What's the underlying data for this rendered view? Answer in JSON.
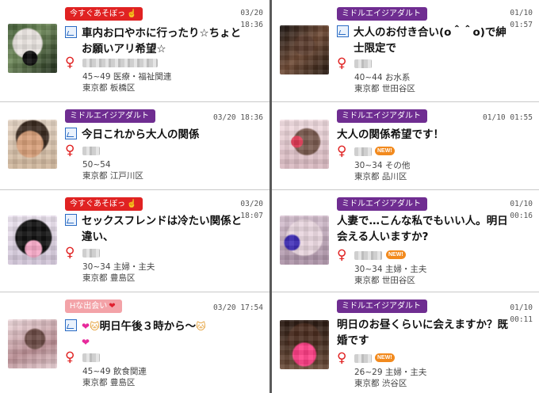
{
  "badges": {
    "now": "今すぐあそぼっ",
    "middle": "ミドルエイジアダルト",
    "h": "Hな出会い"
  },
  "new_label": "NEW!",
  "colors": {
    "now_badge": "#e02222",
    "middle_badge": "#6f2d91",
    "h_badge": "#f3a3a8",
    "gender_icon": "#e02222",
    "new_badge": "#f28a1e"
  },
  "icons": {
    "image": "image-icon",
    "gender": "female-icon",
    "heart": "heart-icon",
    "cat": "cat-face-icon"
  },
  "left": [
    {
      "badge": "今すぐあそぼっ",
      "date": "03/20",
      "time": "18:36",
      "title": "車内お口やホに行ったり☆ちょとお願いアリ希望☆",
      "age_job": "45~49 医療・福祉関連",
      "area": "東京都 板橋区"
    },
    {
      "badge": "ミドルエイジアダルト",
      "date": "03/20",
      "time": "18:36",
      "title": "今日これから大人の関係",
      "age_job": "50~54",
      "area": "東京都 江戸川区"
    },
    {
      "badge": "今すぐあそぼっ",
      "date": "03/20",
      "time": "18:07",
      "title": "セックスフレンドは冷たい関係と違い、",
      "age_job": "30~34 主婦・主夫",
      "area": "東京都 豊島区"
    },
    {
      "badge": "Hな出会い",
      "date": "03/20",
      "time": "17:54",
      "title": "明日午後３時から～",
      "age_job": "45~49 飲食関連",
      "area": "東京都 豊島区"
    }
  ],
  "right": [
    {
      "badge": "ミドルエイジアダルト",
      "date": "01/10",
      "time": "01:57",
      "title": "大人のお付き合い(o＾＾o)で紳士限定で",
      "age_job": "40~44 お水系",
      "area": "東京都 世田谷区"
    },
    {
      "badge": "ミドルエイジアダルト",
      "date": "01/10",
      "time": "01:55",
      "title": "大人の関係希望です！",
      "age_job": "30~34 その他",
      "area": "東京都 品川区"
    },
    {
      "badge": "ミドルエイジアダルト",
      "date": "01/10",
      "time": "00:16",
      "title": "人妻で…こんな私でもいい人。明日会える人いますか?",
      "age_job": "30~34 主婦・主夫",
      "area": "東京都 世田谷区"
    },
    {
      "badge": "ミドルエイジアダルト",
      "date": "01/10",
      "time": "00:11",
      "title": "明日のお昼くらいに会えますか？既婚です",
      "age_job": "26~29 主婦・主夫",
      "area": "東京都 渋谷区"
    }
  ]
}
